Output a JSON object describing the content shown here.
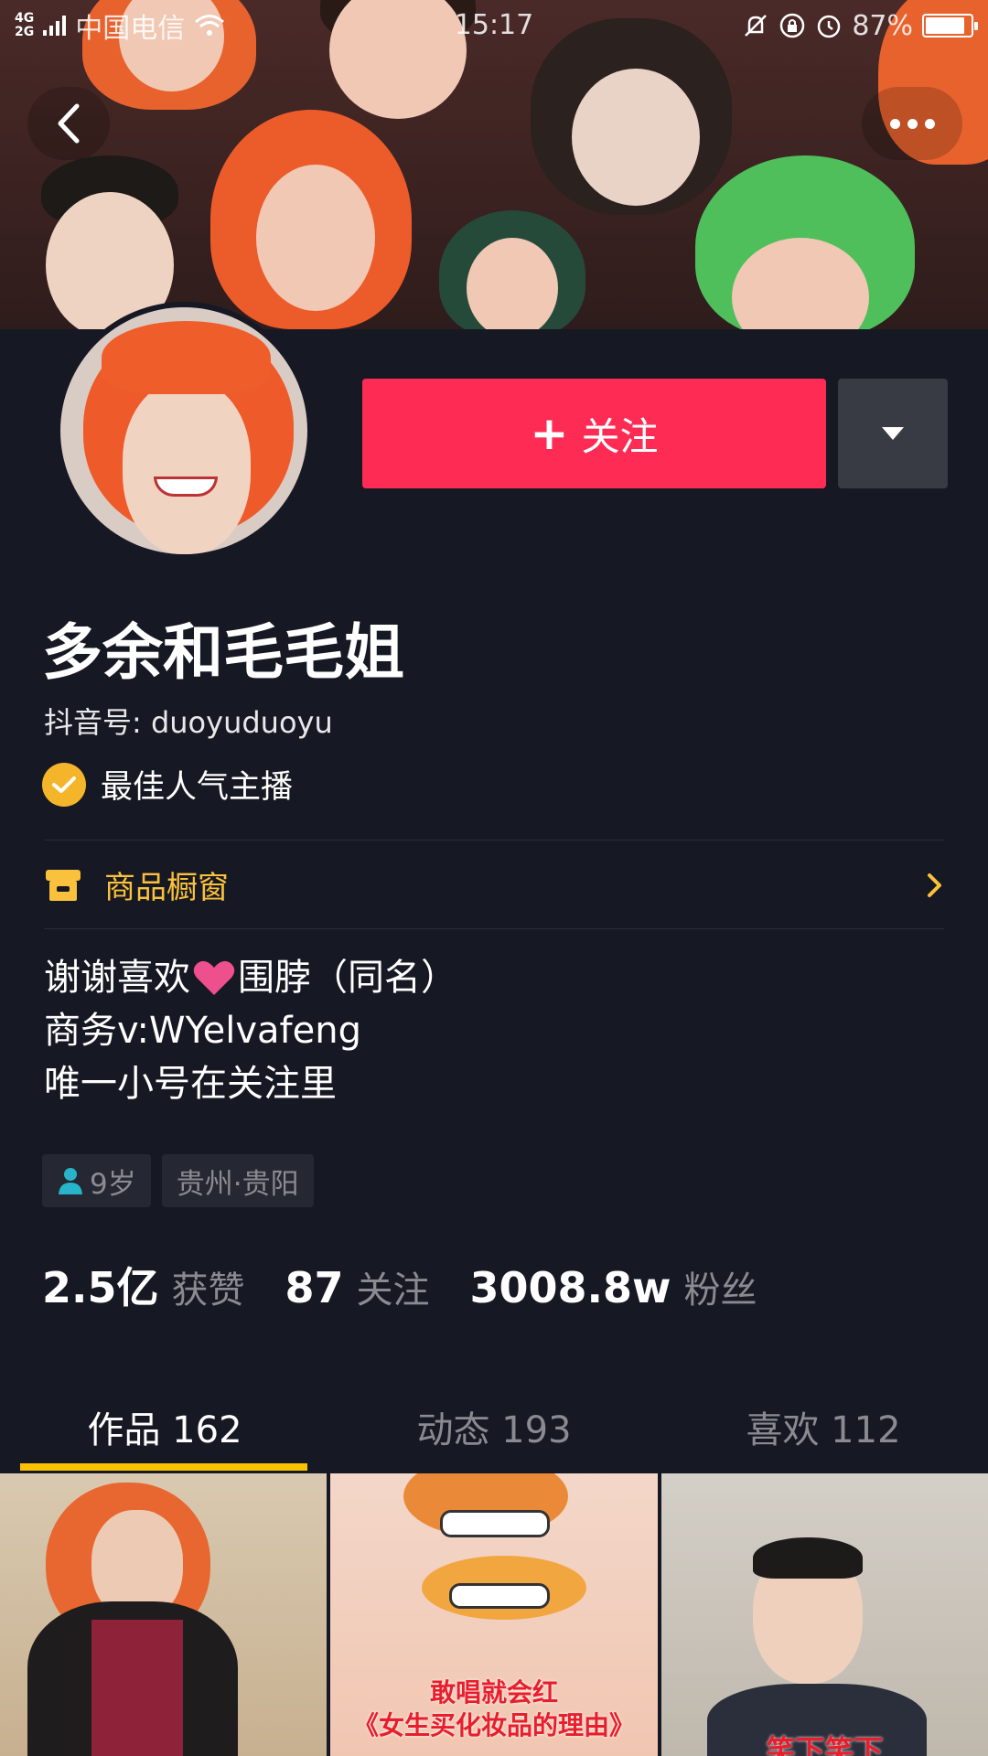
{
  "status_bar": {
    "network_top": "4G",
    "network_bottom": "2G",
    "carrier": "中国电信",
    "time": "15:17",
    "battery": "87%",
    "battery_level": 0.87
  },
  "header": {
    "back_icon": "back-arrow-icon",
    "more_icon": "more-dots-icon"
  },
  "profile": {
    "follow_label": "关注",
    "follow_color": "#fe2c55",
    "nickname": "多余和毛毛姐",
    "douyin_id": "抖音号: duoyuduoyu",
    "award": "最佳人气主播",
    "shop_label": "商品橱窗",
    "bio": {
      "line1_a": "谢谢喜欢",
      "line1_b": "围脖（同名）",
      "line2": "商务v:WYelvafeng",
      "line3": "唯一小号在关注里"
    },
    "tags": {
      "age": "9岁",
      "location": "贵州·贵阳"
    }
  },
  "stats": {
    "likes_value": "2.5亿",
    "likes_label": "获赞",
    "following_value": "87",
    "following_label": "关注",
    "fans_value": "3008.8w",
    "fans_label": "粉丝"
  },
  "tabs": [
    {
      "label": "作品 162"
    },
    {
      "label": "动态 193"
    },
    {
      "label": "喜欢 112"
    }
  ],
  "grid": {
    "cell2_caption_1": "敢唱就会红",
    "cell2_caption_2": "《女生买化妆品的理由》",
    "cell3_caption": "笑下笑下"
  },
  "colors": {
    "background": "#161823",
    "accent": "#fe2c55",
    "shop": "#f9c13c",
    "tab_indicator": "#f9c300",
    "badge": "#f5b52a"
  }
}
